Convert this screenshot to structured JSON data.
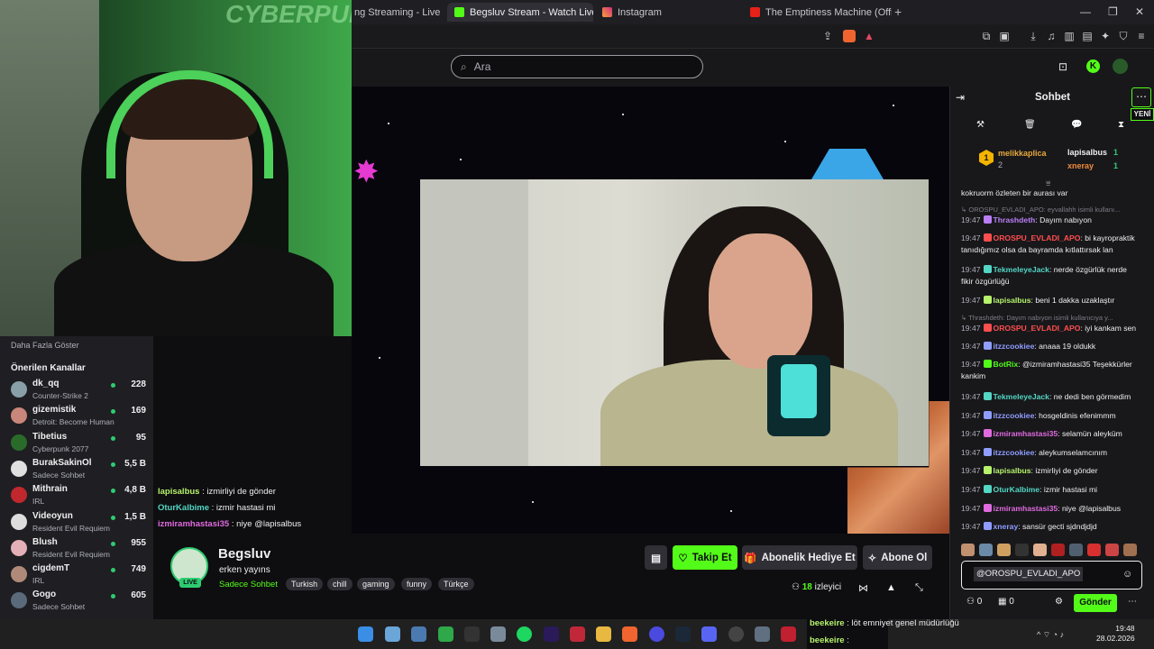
{
  "browser": {
    "tabs": [
      {
        "label": "ng Streaming - Live Stream",
        "active": false
      },
      {
        "label": "Begsluv Stream - Watch Live",
        "active": true
      },
      {
        "label": "Instagram",
        "active": false
      },
      {
        "label": "The Emptiness Machine (Official",
        "active": false
      }
    ],
    "new_tab": "+"
  },
  "topnav": {
    "search_placeholder": "Ara"
  },
  "webcam": {
    "logo_text": "CYBERPUNK"
  },
  "sidebar": {
    "show_more": "Daha Fazla Göster",
    "recommended_title": "Önerilen Kanallar",
    "channels": [
      {
        "name": "dk_qq",
        "game": "Counter-Strike 2",
        "viewers": "228",
        "color": "#8aa0a8"
      },
      {
        "name": "gizemistik",
        "game": "Detroit: Become Human",
        "viewers": "169",
        "color": "#c9867a"
      },
      {
        "name": "Tibetius",
        "game": "Cyberpunk 2077",
        "viewers": "95",
        "color": "#2a6b2a"
      },
      {
        "name": "BurakSakinOl",
        "game": "Sadece Sohbet",
        "viewers": "5,5 B",
        "color": "#e0e0e0"
      },
      {
        "name": "Mithrain",
        "game": "IRL",
        "viewers": "4,8 B",
        "color": "#c0282e"
      },
      {
        "name": "Videoyun",
        "game": "Resident Evil Requiem",
        "viewers": "1,5 B",
        "color": "#dddddd"
      },
      {
        "name": "Blush",
        "game": "Resident Evil Requiem",
        "viewers": "955",
        "color": "#e3b0b8"
      },
      {
        "name": "cigdemT",
        "game": "IRL",
        "viewers": "749",
        "color": "#b08a78"
      },
      {
        "name": "Gogo",
        "game": "Sadece Sohbet",
        "viewers": "605",
        "color": "#5a6a7a"
      }
    ]
  },
  "overlay_chat": [
    {
      "user": "lapisalbus",
      "text": " : izmirliyi de gönder",
      "color": "#b6f36b"
    },
    {
      "user": "OturKalbime",
      "text": " : izmir hastasi mi",
      "color": "#53d6c4"
    },
    {
      "user": "izmiramhastasi35",
      "text": " : niye @lapisalbus",
      "color": "#e06adf"
    }
  ],
  "channel": {
    "name": "Begsluv",
    "title": "erken yayıns",
    "category": "Sadece Sohbet",
    "live": "LIVE",
    "tags": [
      "Turkish",
      "chill",
      "gaming",
      "funny",
      "Türkçe"
    ],
    "viewers_count": "18",
    "viewers_label": "izleyici",
    "follow": "Takip Et",
    "gift": "Abonelik Hediye Et",
    "subscribe": "Abone Ol"
  },
  "chat": {
    "title": "Sohbet",
    "new_label": "YENİ",
    "leaders": [
      {
        "name": "melikkaplica",
        "count": "2",
        "rank": "1"
      },
      {
        "name": "lapisalbus",
        "count": "1"
      },
      {
        "name": "xneray",
        "count": "1"
      }
    ],
    "messages": [
      {
        "time": "",
        "user": "",
        "text": "kokruorm özleten bir aurası var",
        "color": "#efeff1"
      },
      {
        "reply": "↳ OROSPU_EVLADI_APO: eyvallahh isimli kullanı..."
      },
      {
        "time": "19:47",
        "user": "Thrashdeth",
        "text": ": Dayım nabıyon",
        "color": "#b97ef5"
      },
      {
        "time": "19:47",
        "user": "OROSPU_EVLADI_APO",
        "text": ": bi kayropraktik tanıdığımız olsa da bayramda kıtlattırsak lan",
        "color": "#ff4e4e"
      },
      {
        "time": "19:47",
        "user": "TekmeleyeJack",
        "text": ": nerde özgürlük nerde fikir özgürlüğü",
        "color": "#53d6c4"
      },
      {
        "time": "19:47",
        "user": "lapisalbus",
        "text": ": beni 1 dakka uzaklaştır",
        "color": "#b6f36b"
      },
      {
        "reply": "↳ Thrashdeth: Dayım nabıyon isimli kullanıcıya y..."
      },
      {
        "time": "19:47",
        "user": "OROSPU_EVLADI_APO",
        "text": ": iyi kankam sen",
        "color": "#ff4e4e"
      },
      {
        "time": "19:47",
        "user": "itzzcookiee",
        "text": ": anaaa 19 oldukk",
        "color": "#8f9dff"
      },
      {
        "time": "19:47",
        "user": "BotRix",
        "text": ": @izmiramhastasi35 Teşekkürler kankim",
        "color": "#53fc18"
      },
      {
        "time": "19:47",
        "user": "TekmeleyeJack",
        "text": ": ne dedi ben görmedim",
        "color": "#53d6c4"
      },
      {
        "time": "19:47",
        "user": "itzzcookiee",
        "text": ": hosgeldinis efenimmm",
        "color": "#8f9dff"
      },
      {
        "time": "19:47",
        "user": "izmiramhastasi35",
        "text": ": selamün aleyküm",
        "color": "#e06adf"
      },
      {
        "time": "19:47",
        "user": "itzzcookiee",
        "text": ": aleykumselamcınım",
        "color": "#8f9dff"
      },
      {
        "time": "19:47",
        "user": "lapisalbus",
        "text": ": izmirliyi de gönder",
        "color": "#b6f36b"
      },
      {
        "time": "19:47",
        "user": "OturKalbime",
        "text": ": izmir hastasi mi",
        "color": "#53d6c4"
      },
      {
        "time": "19:47",
        "user": "izmiramhastasi35",
        "text": ": niye @lapisalbus",
        "color": "#e06adf"
      },
      {
        "time": "19:47",
        "user": "xneray",
        "text": ": sansür gecti sjdndjdjd",
        "color": "#8f9dff"
      }
    ],
    "input_mention": "@OROSPU_EVLADI_APO",
    "send": "Gönder",
    "points": "0",
    "chests": "0"
  },
  "popup": [
    {
      "user": "beekeire",
      "text": " : löt emniyet genel müdürlüğü"
    },
    {
      "user": "beekeire",
      "text": " :"
    }
  ],
  "taskbar": {
    "time": "19:48",
    "date": "28.02.2026"
  },
  "colors": {
    "brand": "#53fc18",
    "bg": "#0e0e10",
    "panel": "#18181b"
  }
}
